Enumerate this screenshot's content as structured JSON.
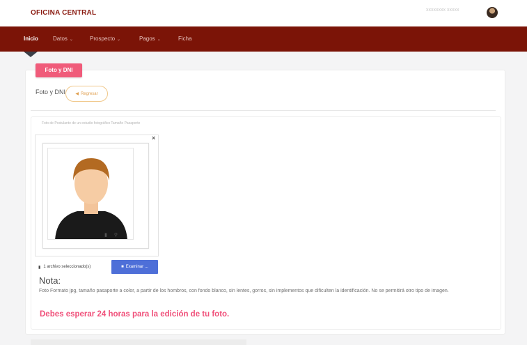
{
  "header": {
    "brand": "OFICINA CENTRAL",
    "user_name": "xxxxxxxx xxxxx"
  },
  "nav": {
    "items": [
      {
        "label": "Inicio",
        "active": true,
        "caret": ""
      },
      {
        "label": "Datos",
        "active": false,
        "caret": "⌄"
      },
      {
        "label": "Prospecto",
        "active": false,
        "caret": "⌄"
      },
      {
        "label": "Pagos",
        "active": false,
        "caret": "⌄"
      },
      {
        "label": "Ficha",
        "active": false,
        "caret": ""
      }
    ]
  },
  "card": {
    "tab_label": "Foto y DNI",
    "section_label": "Foto y DNI",
    "back_button": "Regresar",
    "hint": "Foto de Postulante de un estudio fotográfico Tamaño Pasaporte",
    "file_status": "1 archivo seleccionado(s)",
    "browse_button": "Examinar ...",
    "note_title": "Nota:",
    "note_text": "Foto Formato jpg, tamaño pasaporte a color, a partir de los hombros, con fondo blanco, sin lentes, gorros, sin implementos que dificulten la identificación. No se permitirá otro tipo de imagen.",
    "warning": "Debes esperar 24 horas para la edición de tu foto."
  },
  "icons": {
    "back": "arrow-left-icon",
    "close": "close-icon",
    "trash": "trash-icon",
    "zoom": "zoom-icon",
    "file": "file-icon",
    "folder": "folder-icon"
  },
  "colors": {
    "nav_bg": "#7b1407",
    "tab_accent": "#f05b7a",
    "browse_button": "#4e6fd8",
    "warning": "#f0507a"
  }
}
